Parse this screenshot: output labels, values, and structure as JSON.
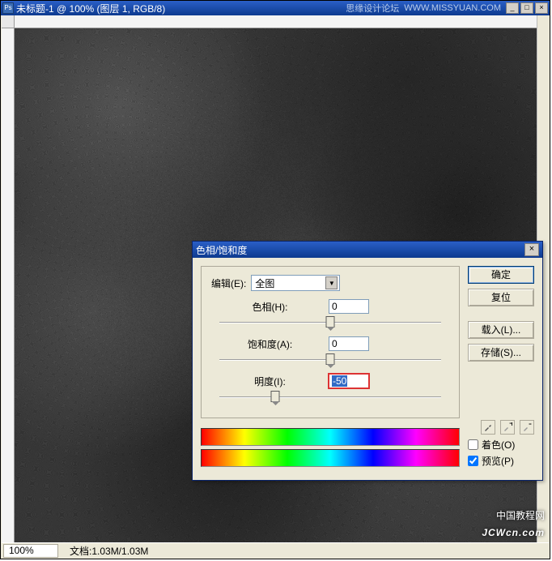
{
  "window": {
    "title": "未标题-1 @ 100% (图层 1, RGB/8)",
    "subtitle": "思缘设计论坛",
    "url": "WWW.MISSYUAN.COM"
  },
  "statusbar": {
    "zoom": "100%",
    "doc": "文档:1.03M/1.03M"
  },
  "dialog": {
    "title": "色相/饱和度",
    "edit_label": "编辑(E):",
    "edit_value": "全图",
    "hue_label": "色相(H):",
    "hue_value": "0",
    "sat_label": "饱和度(A):",
    "sat_value": "0",
    "light_label": "明度(I):",
    "light_value": "-50",
    "buttons": {
      "ok": "确定",
      "reset": "复位",
      "load": "载入(L)...",
      "save": "存储(S)..."
    },
    "colorize_label": "着色(O)",
    "preview_label": "预览(P)",
    "colorize_checked": false,
    "preview_checked": true
  },
  "watermark": {
    "cn": "中国教程网",
    "en": "JCWcn.com"
  },
  "chart_data": {
    "type": "image-adjustment",
    "hue": 0,
    "saturation": 0,
    "lightness": -50,
    "range": {
      "hue": [
        -180,
        180
      ],
      "saturation": [
        -100,
        100
      ],
      "lightness": [
        -100,
        100
      ]
    }
  }
}
